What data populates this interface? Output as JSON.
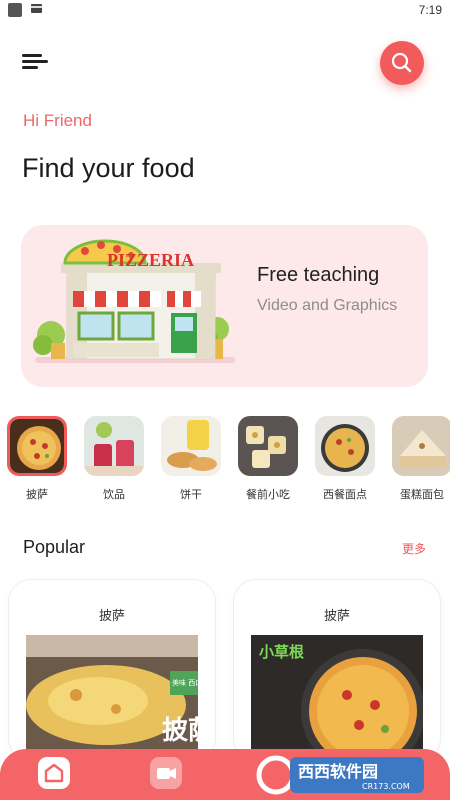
{
  "status_bar": {
    "time": "7:19"
  },
  "header": {
    "greeting": "Hi Friend",
    "title": "Find your food",
    "menu_icon": "menu-icon",
    "search_icon": "search-icon"
  },
  "banner": {
    "sign_text": "PIZZERIA",
    "title": "Free teaching",
    "subtitle": "Video and Graphics"
  },
  "categories": [
    {
      "label": "披萨",
      "selected": true
    },
    {
      "label": "饮品",
      "selected": false
    },
    {
      "label": "饼干",
      "selected": false
    },
    {
      "label": "餐前小吃",
      "selected": false
    },
    {
      "label": "西餐面点",
      "selected": false
    },
    {
      "label": "蛋糕面包",
      "selected": false
    }
  ],
  "popular": {
    "title": "Popular",
    "more": "更多",
    "cards": [
      {
        "title": "披萨",
        "image_text": "披萨",
        "badge": "美味 西口"
      },
      {
        "title": "披萨",
        "image_text": "小草根"
      }
    ]
  },
  "bottom_nav": {
    "items": [
      "home-icon",
      "video-icon"
    ]
  },
  "watermark": {
    "brand": "西西软件园",
    "domain": "CR173.COM"
  },
  "colors": {
    "accent": "#f15b5b",
    "banner_bg": "#fde8ea",
    "nav_bg": "#f46567"
  }
}
